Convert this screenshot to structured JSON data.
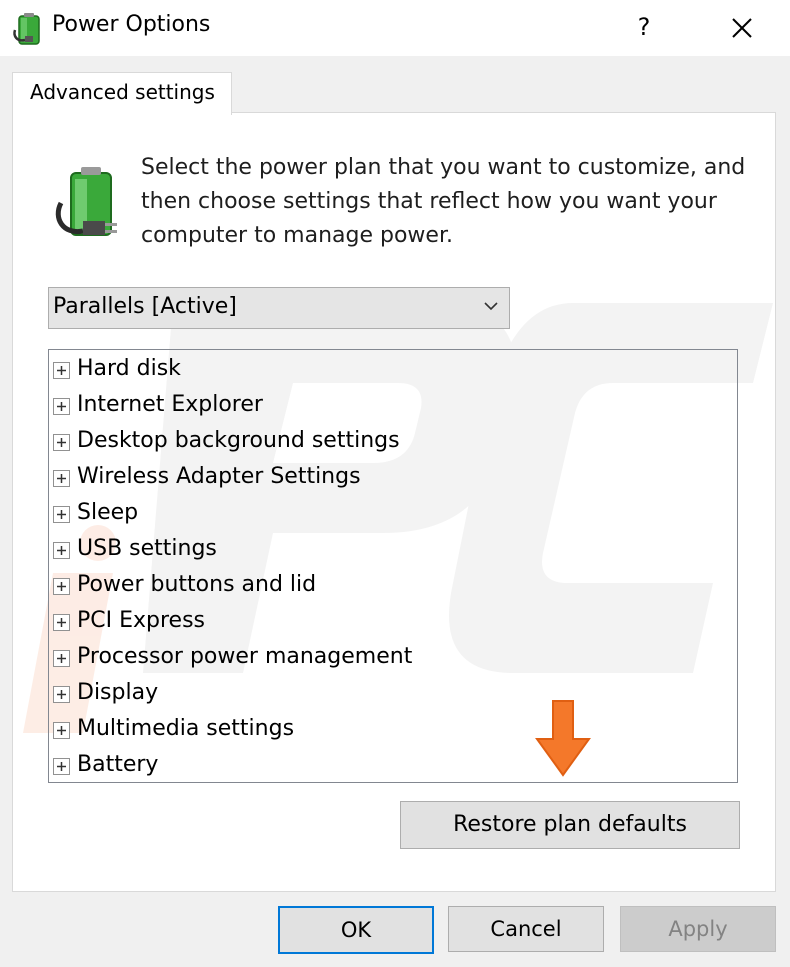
{
  "window": {
    "title": "Power Options",
    "help_label": "?",
    "icons": {
      "app": "power-battery-icon",
      "close": "close-icon"
    }
  },
  "tab": {
    "label": "Advanced settings"
  },
  "header": {
    "description": "Select the power plan that you want to customize, and then choose settings that reflect how you want your computer to manage power.",
    "icon": "power-plan-battery-icon"
  },
  "plan_select": {
    "value": "Parallels [Active]",
    "icon": "chevron-down-icon"
  },
  "settings_tree": {
    "expander_icon": "plus-expander-icon",
    "items": [
      "Hard disk",
      "Internet Explorer",
      "Desktop background settings",
      "Wireless Adapter Settings",
      "Sleep",
      "USB settings",
      "Power buttons and lid",
      "PCI Express",
      "Processor power management",
      "Display",
      "Multimedia settings",
      "Battery"
    ]
  },
  "annotation": {
    "icon": "orange-arrow-down-icon",
    "color": "#f4782a"
  },
  "buttons": {
    "restore": "Restore plan defaults",
    "ok": "OK",
    "cancel": "Cancel",
    "apply": "Apply"
  },
  "colors": {
    "accent": "#0078d7",
    "window_bg": "#f0f0f0",
    "panel_bg": "#ffffff"
  }
}
